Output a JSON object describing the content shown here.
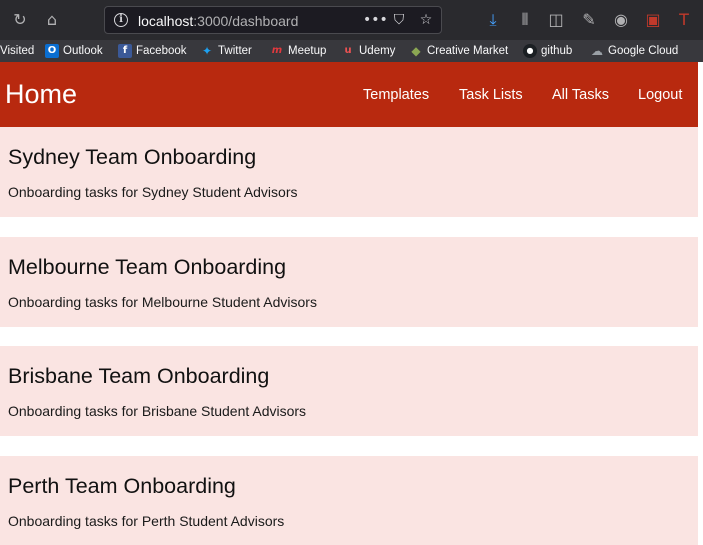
{
  "browser": {
    "url_host": "localhost",
    "url_rest": ":3000/dashboard",
    "icons": [
      "reload-icon",
      "home-icon",
      "info-icon",
      "more-icon",
      "pocket-icon",
      "star-icon",
      "download-icon",
      "library-icon",
      "sidebar-icon",
      "wrench-icon",
      "account-icon",
      "extension-icon",
      "tab-icon"
    ]
  },
  "bookmarks": [
    {
      "label": "Visited"
    },
    {
      "label": "Outlook",
      "icon": "outlook-icon",
      "color": "#0a6ed1",
      "glyph": "O"
    },
    {
      "label": "Facebook",
      "icon": "facebook-icon",
      "color": "#3b5998",
      "glyph": "f"
    },
    {
      "label": "Twitter",
      "icon": "twitter-icon",
      "color": "#1da1f2",
      "glyph": "✦"
    },
    {
      "label": "Meetup",
      "icon": "meetup-icon",
      "color": "#e0393e",
      "glyph": "m"
    },
    {
      "label": "Udemy",
      "icon": "udemy-icon",
      "color": "#ec5252",
      "glyph": "u"
    },
    {
      "label": "Creative Market",
      "icon": "creative-market-icon",
      "color": "#8ba753",
      "glyph": "◆"
    },
    {
      "label": "github",
      "icon": "github-icon",
      "color": "#1b1f23",
      "glyph": "●"
    },
    {
      "label": "Google Cloud",
      "icon": "google-cloud-icon",
      "color": "#5f6368",
      "glyph": "☁"
    }
  ],
  "header": {
    "title": "Home",
    "nav": [
      "Templates",
      "Task Lists",
      "All Tasks",
      "Logout"
    ],
    "color": "#b8290f"
  },
  "cards": [
    {
      "title": "Sydney Team Onboarding",
      "description": "Onboarding tasks for Sydney Student Advisors"
    },
    {
      "title": "Melbourne Team Onboarding",
      "description": "Onboarding tasks for Melbourne Student Advisors"
    },
    {
      "title": "Brisbane Team Onboarding",
      "description": "Onboarding tasks for Brisbane Student Advisors"
    },
    {
      "title": "Perth Team Onboarding",
      "description": "Onboarding tasks for Perth Student Advisors"
    }
  ],
  "card_color": "#fae4e2"
}
